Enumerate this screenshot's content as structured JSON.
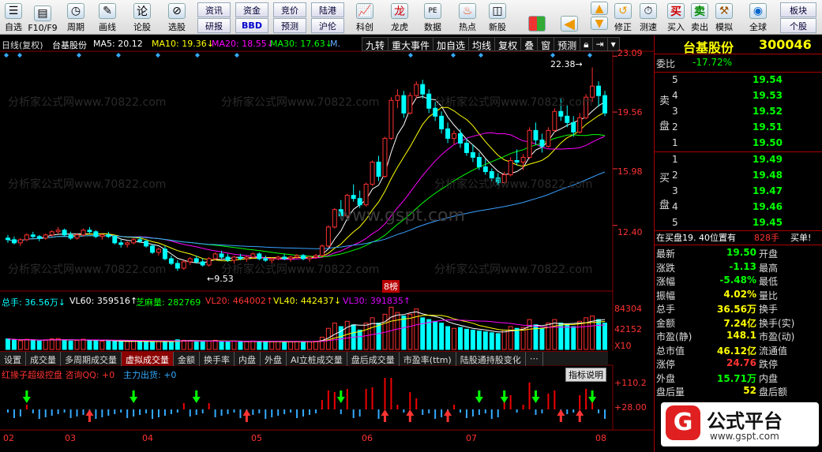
{
  "toolbar": {
    "items": [
      {
        "label": "自选",
        "name": "zixuan"
      },
      {
        "label": "F10/F9",
        "name": "f10"
      },
      {
        "label": "周期",
        "name": "zhouqi"
      },
      {
        "label": "画线",
        "name": "huaxian"
      },
      {
        "label": "论股",
        "name": "lungu"
      },
      {
        "label": "选股",
        "name": "xuangu"
      }
    ],
    "grid": [
      [
        "资讯",
        "资金",
        "竞价",
        "陆港"
      ],
      [
        "研报",
        "BBD",
        "预测",
        "沪伦"
      ]
    ],
    "items2": [
      {
        "label": "科创",
        "name": "kechuang"
      },
      {
        "label": "龙虎",
        "name": "longhu"
      },
      {
        "label": "数据",
        "name": "shuju"
      },
      {
        "label": "热点",
        "name": "redian"
      },
      {
        "label": "新股",
        "name": "xingu"
      }
    ],
    "items3": [
      {
        "label": "修正",
        "name": "xiuzheng"
      },
      {
        "label": "测速",
        "name": "cesu"
      },
      {
        "label": "买入",
        "name": "mairu"
      },
      {
        "label": "卖出",
        "name": "maichu"
      },
      {
        "label": "模拟",
        "name": "moni"
      },
      {
        "label": "全球",
        "name": "quanqiu"
      }
    ],
    "buy": "买",
    "sell": "卖",
    "bk1": "板块",
    "bk2": "个股"
  },
  "chart": {
    "period": "日线(复权)",
    "stock": "台基股份",
    "ma5": "MA5: 20.12",
    "ma10": "MA10: 19.36↓",
    "ma20": "MA20: 18.55↓",
    "ma30": "MA30: 17.63↓",
    "mam": "M.",
    "buttons": [
      "九转",
      "重大事件",
      "加自选",
      "均线",
      "复权",
      "叠",
      "窗",
      "预测"
    ],
    "yaxis": [
      "23.09",
      "19.56",
      "15.98",
      "12.40"
    ],
    "high_label": "22.38→",
    "low_label": "←9.53",
    "flag": "8榜",
    "vol": {
      "zongshou": "总手: 36.56万↓",
      "vl60": "VL60: 359516↑",
      "zhima": "芝麻量: 282769",
      "vl20": "VL20: 464002↑",
      "vl40": "VL40: 442437↓",
      "vl30": "VL30: 391835↑"
    },
    "vol_axis": [
      "84304",
      "42152",
      "X10"
    ],
    "tabs": [
      "设置",
      "成交量",
      "多周期成交量",
      "虚拟成交量",
      "金额",
      "换手率",
      "内盘",
      "外盘",
      "AI立桩成交量",
      "盘后成交量",
      "市盈率(ttm)",
      "陆股通持股变化"
    ],
    "active_tab": "虚拟成交量",
    "ind_title": "红掾子超级控盘 咨询QQ: +0",
    "ind_main": "主力出货: +0",
    "ind_btn": "指标说明",
    "ind_axis": [
      "+110.2",
      "+28.00"
    ],
    "months": [
      "02",
      "03",
      "04",
      "05",
      "06",
      "07",
      "08"
    ],
    "watermark": "www.gspt.com",
    "wm_text": "分析家公式网www.70822.com"
  },
  "quote": {
    "name": "台基股份",
    "code": "300046",
    "weibi_label": "委比",
    "weibi": "-17.72%",
    "sell_label": [
      "卖",
      "盘"
    ],
    "buy_label": [
      "买",
      "盘"
    ],
    "sells": [
      {
        "n": "5",
        "p": "19.54"
      },
      {
        "n": "4",
        "p": "19.53"
      },
      {
        "n": "3",
        "p": "19.52"
      },
      {
        "n": "2",
        "p": "19.51"
      },
      {
        "n": "1",
        "p": "19.50"
      }
    ],
    "buys": [
      {
        "n": "1",
        "p": "19.49"
      },
      {
        "n": "2",
        "p": "19.48"
      },
      {
        "n": "3",
        "p": "19.47"
      },
      {
        "n": "4",
        "p": "19.46"
      },
      {
        "n": "5",
        "p": "19.45"
      }
    ],
    "notice": "在买盘19. 40位置有",
    "notice_qty": "828手",
    "notice_tail": "买单!",
    "stats": [
      {
        "l": "最新",
        "v": "19.50",
        "r": "开盘"
      },
      {
        "l": "涨跌",
        "v": "-1.13",
        "r": "最高"
      },
      {
        "l": "涨幅",
        "v": "-5.48%",
        "r": "最低"
      },
      {
        "l": "振幅",
        "v": "4.02%",
        "r": "量比"
      },
      {
        "l": "总手",
        "v": "36.56万",
        "r": "换手"
      },
      {
        "l": "金额",
        "v": "7.24亿",
        "r": "换手(实)"
      },
      {
        "l": "市盈(静)",
        "v": "148.1",
        "r": "市盈(动)"
      },
      {
        "l": "总市值",
        "v": "46.12亿",
        "r": "流通值"
      },
      {
        "l": "涨停",
        "v": "24.76",
        "r": "跌停"
      },
      {
        "l": "外盘",
        "v": "15.71万",
        "r": "内盘"
      },
      {
        "l": "盘后量",
        "v": "52",
        "r": "盘后额"
      }
    ],
    "logo": "公式平台",
    "logo_url": "www.gspt.com"
  },
  "colors": {
    "up": "#ff3030",
    "down": "#00ffff",
    "ma5": "#ffffff",
    "ma10": "#ffff00",
    "ma20": "#ff00ff",
    "ma30": "#00ff00",
    "ma60": "#3aa0ff"
  },
  "kline": [
    [
      11.6,
      11.8,
      11.3,
      11.5
    ],
    [
      11.5,
      11.7,
      11.2,
      11.3
    ],
    [
      11.3,
      11.6,
      11.1,
      11.5
    ],
    [
      11.5,
      11.9,
      11.4,
      11.8
    ],
    [
      11.8,
      12.0,
      11.6,
      11.7
    ],
    [
      11.7,
      11.8,
      11.4,
      11.6
    ],
    [
      11.6,
      11.9,
      11.5,
      11.8
    ],
    [
      11.8,
      12.1,
      11.7,
      12.0
    ],
    [
      12.0,
      12.3,
      11.9,
      12.1
    ],
    [
      12.1,
      12.2,
      11.7,
      11.8
    ],
    [
      11.8,
      12.0,
      11.5,
      11.6
    ],
    [
      11.6,
      11.9,
      11.5,
      11.8
    ],
    [
      11.8,
      12.2,
      11.7,
      12.1
    ],
    [
      12.1,
      12.3,
      11.9,
      12.0
    ],
    [
      12.0,
      12.1,
      11.6,
      11.7
    ],
    [
      11.7,
      11.9,
      11.5,
      11.8
    ],
    [
      11.8,
      12.0,
      11.6,
      11.7
    ],
    [
      11.7,
      11.8,
      11.2,
      11.3
    ],
    [
      11.3,
      11.5,
      11.0,
      11.2
    ],
    [
      11.2,
      11.4,
      11.0,
      11.3
    ],
    [
      11.3,
      11.6,
      11.2,
      11.5
    ],
    [
      11.5,
      11.7,
      11.3,
      11.4
    ],
    [
      11.4,
      11.5,
      11.0,
      11.1
    ],
    [
      11.1,
      11.2,
      10.6,
      10.7
    ],
    [
      10.7,
      11.0,
      10.5,
      10.9
    ],
    [
      10.9,
      11.1,
      10.2,
      10.3
    ],
    [
      10.3,
      10.5,
      9.9,
      10.0
    ],
    [
      10.0,
      10.2,
      9.53,
      9.7
    ],
    [
      9.7,
      10.2,
      9.6,
      10.1
    ],
    [
      10.1,
      10.4,
      9.9,
      10.3
    ],
    [
      10.3,
      10.5,
      10.0,
      10.1
    ],
    [
      10.1,
      10.3,
      9.8,
      9.9
    ],
    [
      9.9,
      10.4,
      9.8,
      10.3
    ],
    [
      10.3,
      10.7,
      10.2,
      10.6
    ],
    [
      10.6,
      10.8,
      10.3,
      10.4
    ],
    [
      10.4,
      10.6,
      10.1,
      10.2
    ],
    [
      10.2,
      10.5,
      10.0,
      10.4
    ],
    [
      10.4,
      10.6,
      10.2,
      10.3
    ],
    [
      10.3,
      10.5,
      10.1,
      10.4
    ],
    [
      10.4,
      10.7,
      10.3,
      10.6
    ],
    [
      10.6,
      10.7,
      10.2,
      10.3
    ],
    [
      10.3,
      10.5,
      10.1,
      10.2
    ],
    [
      10.2,
      10.4,
      10.0,
      10.3
    ],
    [
      10.3,
      10.5,
      10.2,
      10.4
    ],
    [
      10.4,
      10.6,
      10.2,
      10.3
    ],
    [
      10.3,
      10.5,
      10.1,
      10.4
    ],
    [
      10.4,
      10.6,
      10.3,
      10.5
    ],
    [
      10.5,
      10.6,
      10.2,
      10.3
    ],
    [
      10.3,
      10.5,
      10.1,
      10.4
    ],
    [
      10.4,
      10.6,
      10.3,
      10.5
    ],
    [
      10.5,
      11.2,
      10.4,
      11.1
    ],
    [
      11.1,
      12.4,
      11.0,
      12.3
    ],
    [
      12.3,
      13.5,
      12.2,
      13.4
    ],
    [
      13.4,
      14.0,
      12.8,
      13.0
    ],
    [
      13.0,
      14.4,
      12.9,
      14.3
    ],
    [
      14.3,
      15.0,
      13.9,
      14.1
    ],
    [
      14.1,
      14.6,
      13.5,
      13.7
    ],
    [
      13.7,
      15.1,
      13.6,
      15.0
    ],
    [
      15.0,
      16.5,
      14.9,
      16.4
    ],
    [
      16.4,
      16.8,
      15.2,
      15.5
    ],
    [
      15.5,
      18.0,
      15.4,
      17.9
    ],
    [
      17.9,
      20.5,
      17.8,
      20.3
    ],
    [
      20.3,
      21.0,
      19.8,
      20.6
    ],
    [
      20.6,
      20.9,
      19.2,
      19.5
    ],
    [
      19.5,
      20.8,
      19.4,
      20.6
    ],
    [
      20.6,
      21.5,
      20.4,
      21.3
    ],
    [
      21.3,
      21.6,
      20.4,
      20.7
    ],
    [
      20.7,
      21.0,
      19.5,
      19.8
    ],
    [
      19.8,
      20.2,
      19.0,
      19.3
    ],
    [
      19.3,
      19.6,
      18.2,
      18.5
    ],
    [
      18.5,
      18.9,
      17.6,
      17.9
    ],
    [
      17.9,
      18.4,
      17.5,
      18.2
    ],
    [
      18.2,
      18.5,
      17.3,
      17.6
    ],
    [
      17.6,
      17.9,
      16.8,
      17.0
    ],
    [
      17.0,
      17.5,
      16.4,
      16.7
    ],
    [
      16.7,
      17.0,
      15.9,
      16.1
    ],
    [
      16.1,
      16.6,
      15.6,
      15.8
    ],
    [
      15.8,
      16.0,
      15.2,
      15.4
    ],
    [
      15.4,
      15.7,
      14.9,
      15.1
    ],
    [
      15.1,
      15.8,
      15.0,
      15.6
    ],
    [
      15.6,
      16.7,
      15.5,
      16.5
    ],
    [
      16.5,
      17.2,
      16.2,
      16.4
    ],
    [
      16.4,
      16.9,
      15.9,
      16.7
    ],
    [
      16.7,
      18.6,
      16.6,
      18.4
    ],
    [
      18.4,
      18.9,
      17.5,
      17.8
    ],
    [
      17.8,
      18.2,
      17.0,
      17.4
    ],
    [
      17.4,
      18.6,
      17.3,
      18.4
    ],
    [
      18.4,
      19.8,
      18.3,
      19.6
    ],
    [
      19.6,
      20.4,
      19.0,
      19.3
    ],
    [
      19.3,
      20.0,
      18.6,
      18.9
    ],
    [
      18.9,
      19.3,
      18.0,
      18.3
    ],
    [
      18.3,
      19.5,
      18.2,
      19.2
    ],
    [
      19.2,
      20.7,
      19.1,
      20.5
    ],
    [
      20.5,
      22.38,
      20.2,
      21.2
    ],
    [
      21.2,
      21.5,
      19.9,
      20.6
    ],
    [
      20.6,
      20.9,
      19.3,
      19.5
    ]
  ],
  "volume": [
    60,
    55,
    50,
    58,
    52,
    48,
    55,
    60,
    62,
    50,
    48,
    52,
    58,
    54,
    50,
    47,
    49,
    46,
    44,
    45,
    48,
    46,
    44,
    42,
    45,
    48,
    46,
    55,
    52,
    50,
    45,
    44,
    48,
    52,
    47,
    44,
    46,
    45,
    44,
    48,
    43,
    42,
    44,
    45,
    43,
    44,
    46,
    43,
    44,
    47,
    70,
    120,
    150,
    130,
    160,
    140,
    110,
    150,
    180,
    150,
    200,
    240,
    210,
    190,
    200,
    230,
    180,
    170,
    160,
    150,
    130,
    120,
    125,
    115,
    110,
    105,
    100,
    95,
    90,
    110,
    130,
    120,
    125,
    170,
    140,
    120,
    150,
    170,
    150,
    140,
    130,
    160,
    180,
    190,
    170,
    150
  ],
  "signals": [
    {
      "i": 3,
      "d": "down"
    },
    {
      "i": 13,
      "d": "up"
    },
    {
      "i": 20,
      "d": "down"
    },
    {
      "i": 30,
      "d": "down"
    },
    {
      "i": 38,
      "d": "up"
    },
    {
      "i": 53,
      "d": "down"
    },
    {
      "i": 60,
      "d": "up"
    },
    {
      "i": 64,
      "d": "up"
    },
    {
      "i": 70,
      "d": "up"
    },
    {
      "i": 75,
      "d": "down"
    },
    {
      "i": 79,
      "d": "down"
    },
    {
      "i": 84,
      "d": "down"
    },
    {
      "i": 88,
      "d": "up"
    },
    {
      "i": 91,
      "d": "up"
    },
    {
      "i": 93,
      "d": "down"
    }
  ]
}
